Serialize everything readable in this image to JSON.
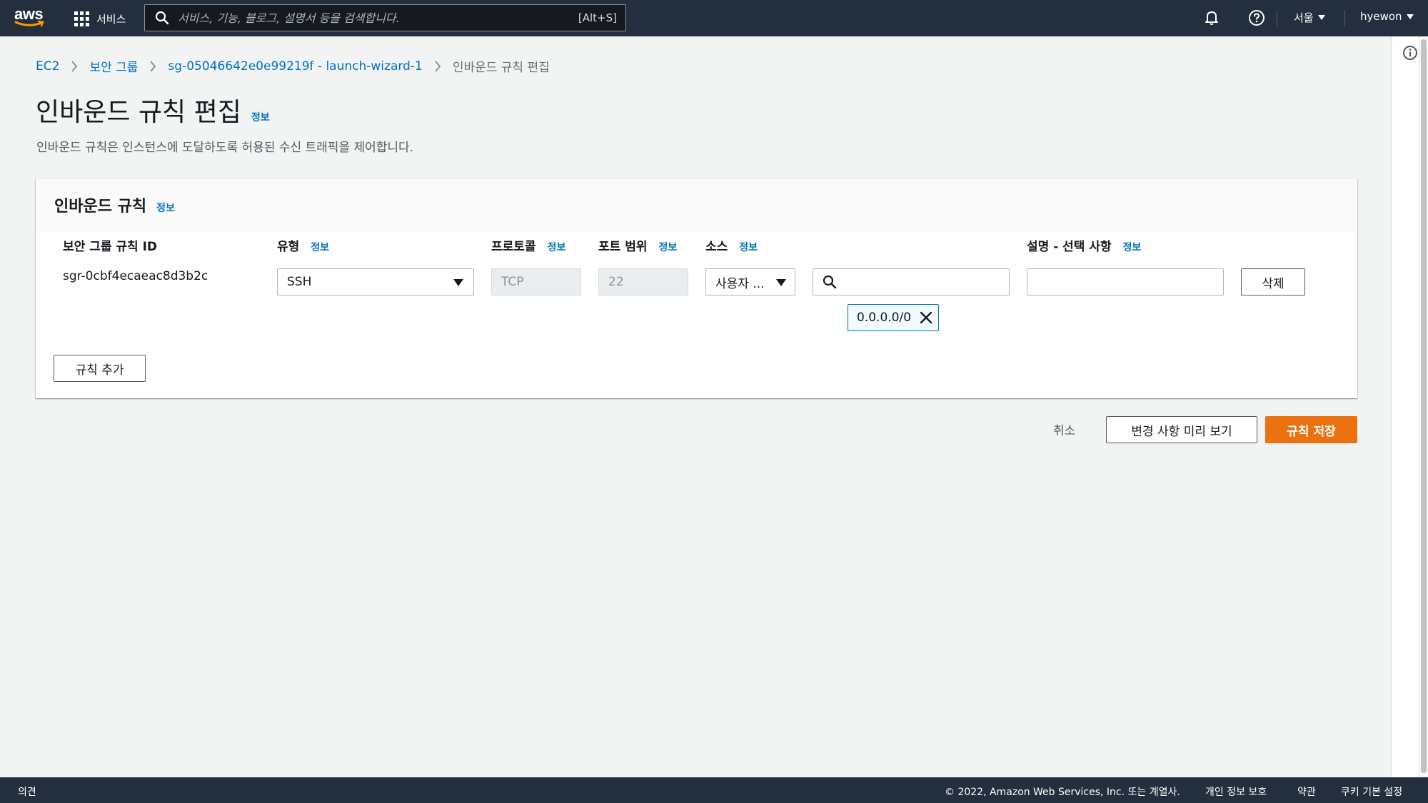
{
  "topnav": {
    "logo_text": "aws",
    "services_label": "서비스",
    "search_placeholder": "서비스, 기능, 블로그, 설명서 등을 검색합니다.",
    "search_shortcut": "[Alt+S]",
    "region_label": "서울",
    "user_label": "hyewon"
  },
  "breadcrumb": {
    "items": [
      "EC2",
      "보안 그룹",
      "sg-05046642e0e99219f - launch-wizard-1"
    ],
    "current": "인바운드 규칙 편집"
  },
  "page": {
    "title": "인바운드 규칙 편집",
    "info_label": "정보",
    "description": "인바운드 규칙은 인스턴스에 도달하도록 허용된 수신 트래픽을 제어합니다."
  },
  "rules_panel": {
    "title": "인바운드 규칙",
    "info_label": "정보",
    "columns": {
      "rule_id": "보안 그룹 규칙 ID",
      "type": "유형",
      "protocol": "프로토콜",
      "port_range": "포트 범위",
      "source": "소스",
      "description": "설명 - 선택 사항"
    },
    "rows": [
      {
        "rule_id": "sgr-0cbf4ecaeac8d3b2c",
        "type": "SSH",
        "protocol": "TCP",
        "port_range": "22",
        "source_type": "사용자 ...",
        "source_search_value": "",
        "source_token": "0.0.0.0/0",
        "description_value": "",
        "delete_label": "삭제"
      }
    ],
    "add_rule_label": "규칙 추가"
  },
  "actions": {
    "cancel_label": "취소",
    "preview_label": "변경 사항 미리 보기",
    "save_label": "규칙 저장"
  },
  "footer": {
    "feedback_label": "의견",
    "copyright": "© 2022, Amazon Web Services, Inc. 또는 계열사.",
    "privacy_label": "개인 정보 보호",
    "terms_label": "약관",
    "cookie_label": "쿠키 기본 설정"
  },
  "colors": {
    "nav_bg": "#232f3e",
    "link": "#0073bb",
    "primary": "#ec7211",
    "page_bg": "#f2f3f3"
  },
  "icons": [
    "aws-logo",
    "grid-icon",
    "search-icon",
    "bell-icon",
    "help-icon",
    "chevron-right-icon",
    "caret-down-icon",
    "close-icon",
    "info-icon"
  ]
}
